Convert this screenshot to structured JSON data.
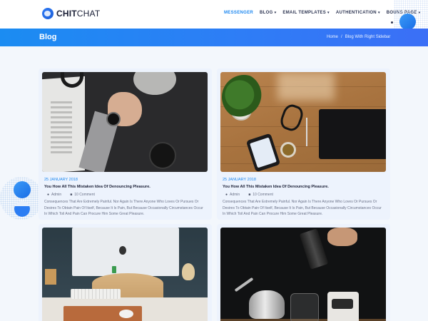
{
  "header": {
    "logo_bold": "CHIT",
    "logo_light": "CHAT",
    "nav": [
      {
        "label": "MESSENGER",
        "active": true,
        "has_dropdown": false
      },
      {
        "label": "BLOG",
        "active": false,
        "has_dropdown": true
      },
      {
        "label": "EMAIL TEMPLATES",
        "active": false,
        "has_dropdown": true
      },
      {
        "label": "AUTHENTICATION",
        "active": false,
        "has_dropdown": true
      },
      {
        "label": "BOUNS PAGE",
        "active": false,
        "has_dropdown": true
      }
    ],
    "caret_glyph": "▾"
  },
  "banner": {
    "title": "Blog",
    "breadcrumb": [
      "Home",
      "Blog With Right Sidebar"
    ],
    "separator": "/"
  },
  "colors": {
    "accent": "#1e88f0",
    "banner_start": "#1b8cf2",
    "banner_end": "#3b6ff6",
    "card_bg": "#edf3fd",
    "page_bg": "#f3f7fc"
  },
  "posts": [
    {
      "image": "hand-with-watch-photo",
      "date": "25 JANUARY 2018",
      "title": "You How All This Mistaken Idea Of Denouncing Pleasure.",
      "author": "Admin",
      "comments": "10 Comment",
      "excerpt": "Consequences That Are Extremely Painful. Nor Again Is There Anyone Who Loves Or Pursues Or Desires To Obtain Pain Of Itself, Because It Is Pain, But Because Occasionally Circumstances Occur In Which Toil And Pain Can Procure Him Some Great Pleasure."
    },
    {
      "image": "wood-desk-photo",
      "date": "25 JANUARY 2018",
      "title": "You How All This Mistaken Idea Of Denouncing Pleasure.",
      "author": "Admin",
      "comments": "10 Comment",
      "excerpt": "Consequences That Are Extremely Painful. Nor Again Is There Anyone Who Loves Or Pursues Or Desires To Obtain Pain Of Itself, Because It Is Pain, But Because Occasionally Circumstances Occur In Which Toil And Pain Can Procure Him Some Great Pleasure."
    },
    {
      "image": "desk-setup-photo"
    },
    {
      "image": "coffee-brewing-photo"
    }
  ],
  "icons": {
    "author": "user-icon",
    "comments": "comment-icon"
  }
}
